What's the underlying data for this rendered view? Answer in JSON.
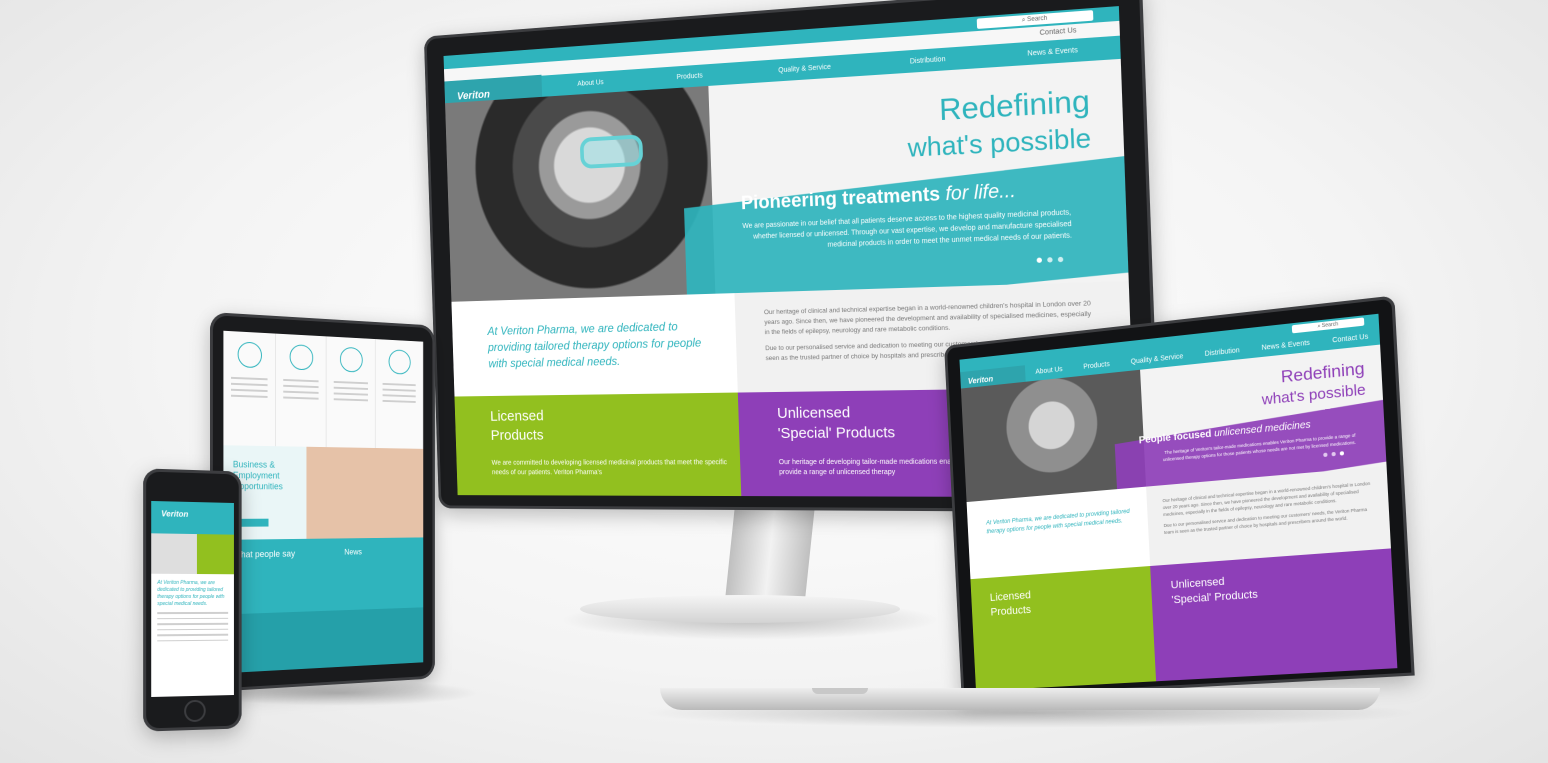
{
  "monitor": {
    "search_label": "Search",
    "contact_link": "Contact Us",
    "logo": "Veriton",
    "nav": [
      "About Us",
      "Products",
      "Quality & Service",
      "Distribution",
      "News & Events"
    ],
    "hero": {
      "title_line1": "Redefining",
      "title_line2": "what's possible",
      "band_title": "Pioneering treatments",
      "band_title_italic": "for life...",
      "band_text": "We are passionate in our belief that all patients deserve access to the highest quality medicinal products, whether licensed or unlicensed. Through our vast expertise, we develop and manufacture specialised medicinal products in order to meet the unmet medical needs of our patients."
    },
    "intro": "At Veriton Pharma, we are dedicated to providing tailored therapy options for people with special medical needs.",
    "heritage": [
      "Our heritage of clinical and technical expertise began in a world-renowned children's hospital in London over 20 years ago. Since then, we have pioneered the development and availability of specialised medicines, especially in the fields of epilepsy, neurology and rare metabolic conditions.",
      "Due to our personalised service and dedication to meeting our customers' needs, the Veriton Pharma team is seen as the trusted partner of choice by hospitals and prescribers around the world."
    ],
    "tile_green": {
      "title_line1": "Licensed",
      "title_line2": "Products",
      "text": "We are committed to developing licensed medicinal products that meet the specific needs of our patients. Veriton Pharma's"
    },
    "tile_purple": {
      "title_line1": "Unlicensed",
      "title_line2": "'Special' Products",
      "text": "Our heritage of developing tailor-made medications enables Veriton Pharma to provide a range of unlicensed therapy"
    }
  },
  "tablet": {
    "hero_title": "Business & Employment Opportunities",
    "sub_left": "What people say",
    "sub_right": "News"
  },
  "phone": {
    "logo": "Veriton",
    "intro": "At Veriton Pharma, we are dedicated to providing tailored therapy options for people with special medical needs."
  },
  "laptop": {
    "search_label": "Search",
    "logo": "Veriton",
    "nav": [
      "About Us",
      "Products",
      "Quality & Service",
      "Distribution",
      "News & Events",
      "Contact Us"
    ],
    "hero": {
      "title_line1": "Redefining",
      "title_line2": "what's possible",
      "band_title": "People focused",
      "band_title_italic": "unlicensed medicines",
      "band_text": "The heritage of Veriton's tailor-made medications enables Veriton Pharma to provide a range of unlicensed therapy options for those patients whose needs are not met by licensed medications."
    },
    "intro": "At Veriton Pharma, we are dedicated to providing tailored therapy options for people with special medical needs.",
    "heritage": [
      "Our heritage of clinical and technical expertise began in a world-renowned children's hospital in London over 20 years ago. Since then, we have pioneered the development and availability of specialised medicines, especially in the fields of epilepsy, neurology and rare metabolic conditions.",
      "Due to our personalised service and dedication to meeting our customers' needs, the Veriton Pharma team is seen as the trusted partner of choice by hospitals and prescribers around the world."
    ],
    "tile_green": {
      "title_line1": "Licensed",
      "title_line2": "Products"
    },
    "tile_purple": {
      "title_line1": "Unlicensed",
      "title_line2": "'Special' Products"
    }
  },
  "colors": {
    "teal": "#2fb4bd",
    "green": "#92c01f",
    "purple": "#8e3fb8"
  }
}
